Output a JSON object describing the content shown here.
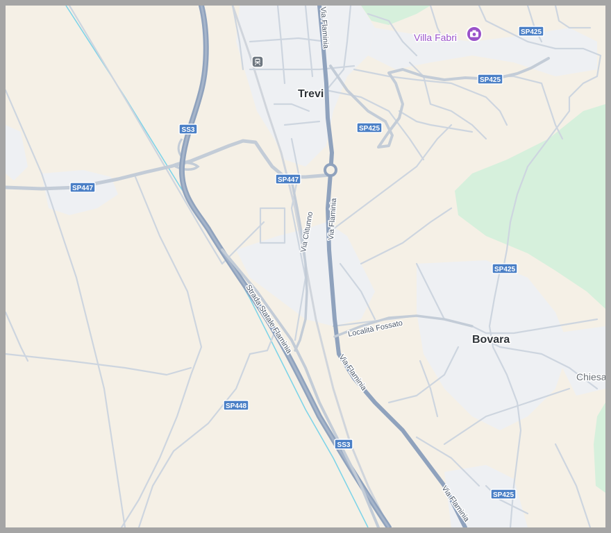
{
  "map": {
    "places": {
      "trevi": "Trevi",
      "bovara": "Bovara",
      "chiesa": "Chiesa",
      "villa_fabri": "Villa Fabri"
    },
    "roads": {
      "via_flaminia": "Via Flaminia",
      "via_clitunno": "Via Clitunno",
      "strada_statale_flaminia": "Strada Statale Flaminia",
      "localita_fossato": "Località Fossato"
    },
    "shields": {
      "ss3": "SS3",
      "sp447": "SP447",
      "sp448": "SP448",
      "sp425": "SP425"
    },
    "icons": {
      "poi": "camera-icon",
      "transit": "train-station-icon"
    },
    "colors": {
      "land": "#f5f0e6",
      "park": "#d6f0dc",
      "urban": "#eef0f3",
      "highway": "#8fa2bd",
      "road": "#c9d2dd",
      "water": "#7fd4e8",
      "shield": "#4a7fc6",
      "poi": "#9a52c9"
    }
  }
}
